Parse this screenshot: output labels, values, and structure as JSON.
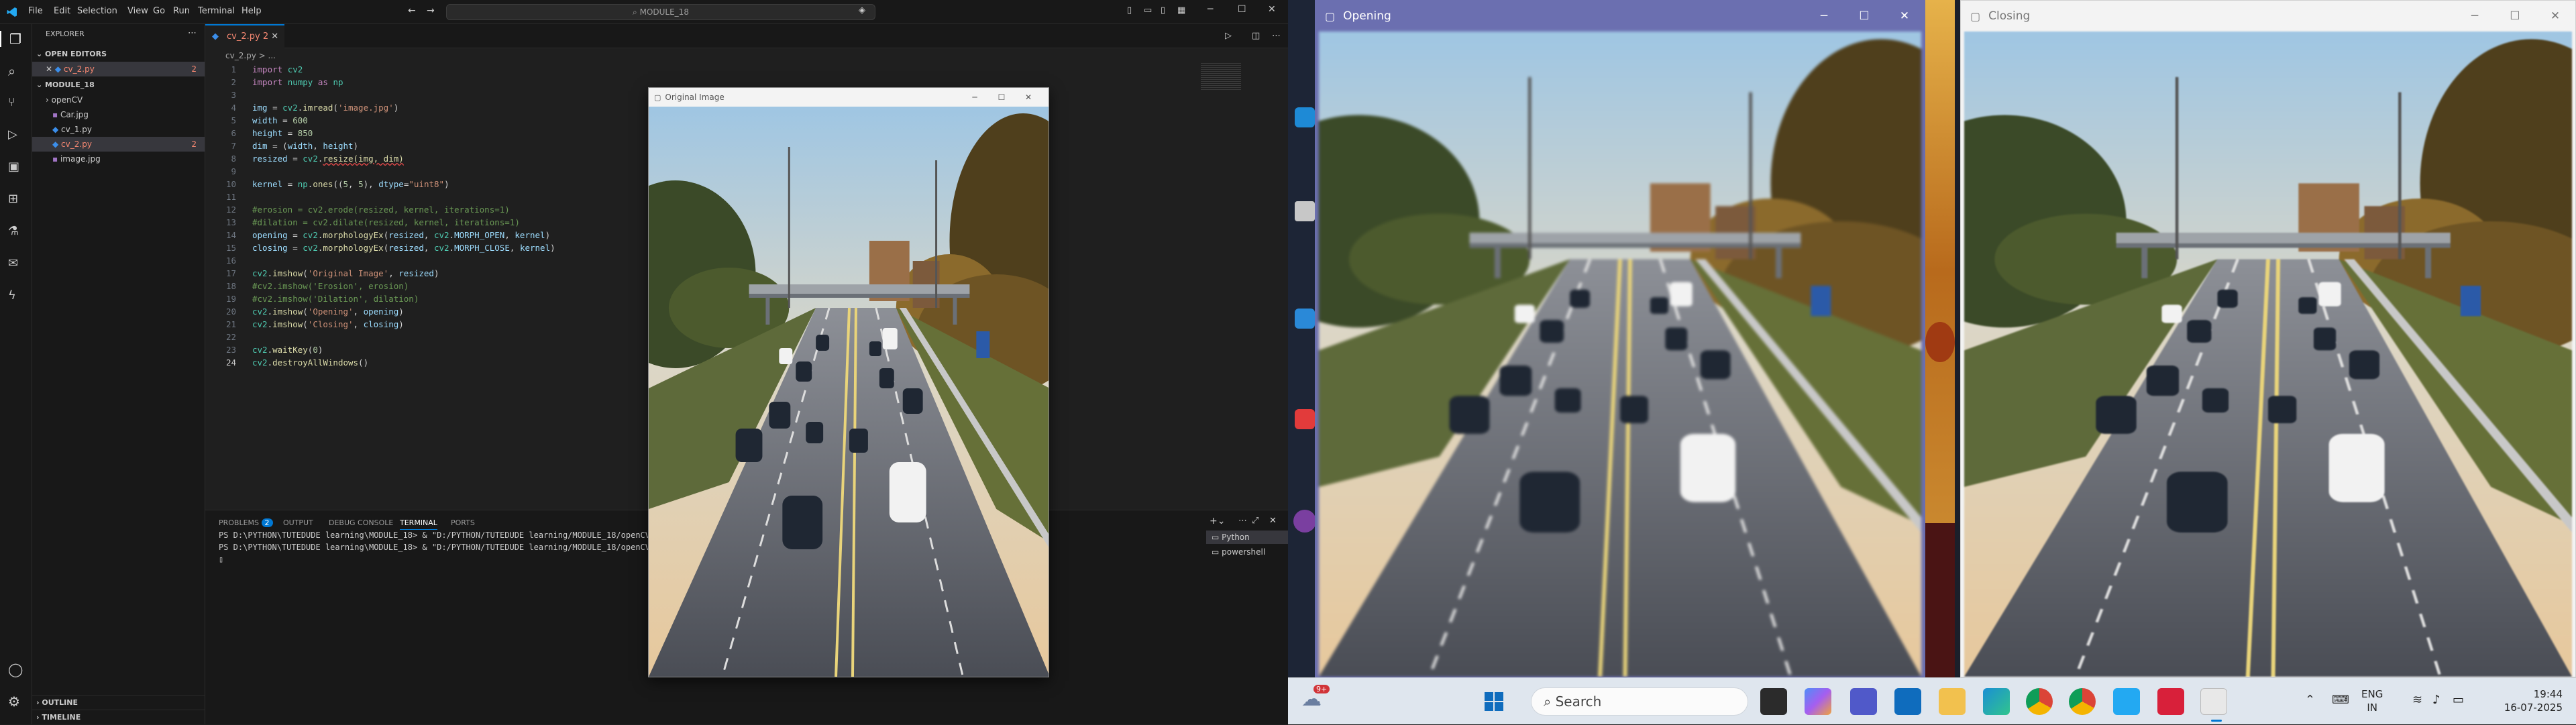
{
  "vscode": {
    "menu": [
      "File",
      "Edit",
      "Selection",
      "View",
      "Go",
      "Run",
      "Terminal",
      "Help"
    ],
    "search_text": "MODULE_18",
    "explorer_title": "EXPLORER",
    "open_editors_title": "OPEN EDITORS",
    "open_editor_file": "cv_2.py",
    "open_editor_badge": "2",
    "folder_title": "MODULE_18",
    "files": [
      {
        "name": "openCV",
        "kind": "folder"
      },
      {
        "name": "Car.jpg",
        "kind": "image"
      },
      {
        "name": "cv_1.py",
        "kind": "python"
      },
      {
        "name": "cv_2.py",
        "kind": "python",
        "badge": "2"
      },
      {
        "name": "image.jpg",
        "kind": "image"
      }
    ],
    "outline_label": "OUTLINE",
    "timeline_label": "TIMELINE",
    "tab_label": "cv_2.py",
    "tab_badge": "2",
    "breadcrumb": "cv_2.py > ...",
    "code_lines": [
      "import cv2",
      "import numpy as np",
      "",
      "img = cv2.imread('image.jpg')",
      "width = 600",
      "height = 850",
      "dim = (width, height)",
      "resized = cv2.resize(img, dim)",
      "",
      "kernel = np.ones((5, 5), dtype=\"uint8\")",
      "",
      "#erosion = cv2.erode(resized, kernel, iterations=1)",
      "#dilation = cv2.dilate(resized, kernel, iterations=1)",
      "opening = cv2.morphologyEx(resized, cv2.MORPH_OPEN, kernel)",
      "closing = cv2.morphologyEx(resized, cv2.MORPH_CLOSE, kernel)",
      "",
      "cv2.imshow('Original Image', resized)",
      "#cv2.imshow('Erosion', erosion)",
      "#cv2.imshow('Dilation', dilation)",
      "cv2.imshow('Opening', opening)",
      "cv2.imshow('Closing', closing)",
      "",
      "cv2.waitKey(0)",
      "cv2.destroyAllWindows()"
    ],
    "panel_tabs": [
      "PROBLEMS",
      "OUTPUT",
      "DEBUG CONSOLE",
      "TERMINAL",
      "PORTS"
    ],
    "problems_badge": "2",
    "terminal_lines": [
      "PS D:\\PYTHON\\TUTEDUDE learning\\MODULE_18> & \"D:/PYTHON/TUTEDUDE learning/MODULE_18/openCV/S",
      "PS D:\\PYTHON\\TUTEDUDE learning\\MODULE_18> & \"D:/PYTHON/TUTEDUDE learning/MODULE_18/openCV/S"
    ],
    "terminal_sessions": [
      "Python",
      "powershell"
    ]
  },
  "windows": {
    "original_title": "Original Image",
    "opening_title": "Opening",
    "closing_title": "Closing"
  },
  "taskbar": {
    "search_placeholder": "Search",
    "weather_badge": "9+",
    "lang_top": "ENG",
    "lang_bottom": "IN",
    "time": "19:44",
    "date": "16-07-2025"
  },
  "colors": {
    "accent": "#0078d4",
    "opening_titlebar": "#6b6fb0",
    "closing_titlebar": "#f3f3f3",
    "error_red": "#f14c4c"
  }
}
